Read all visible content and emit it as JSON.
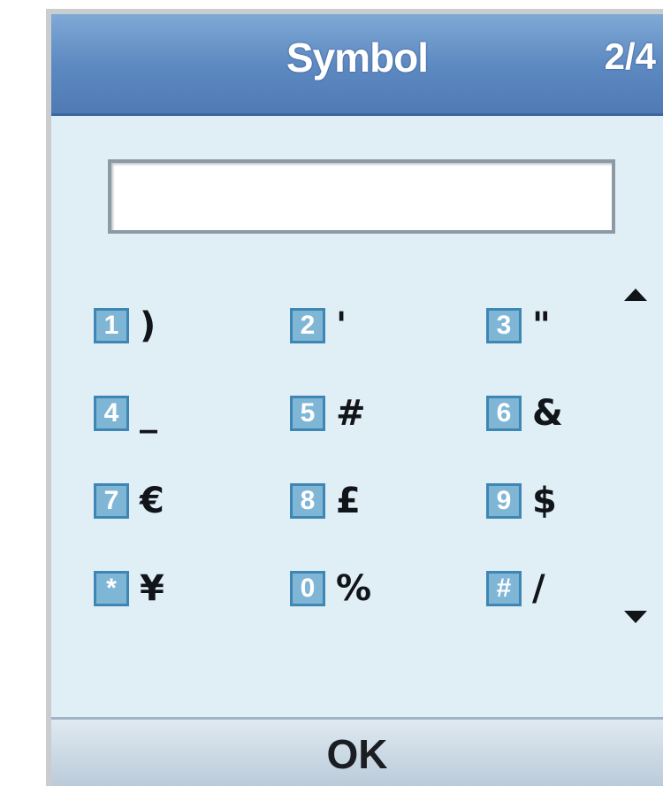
{
  "dialog": {
    "title": "Symbol",
    "page_indicator": "2/4",
    "input_value": ""
  },
  "symbols": [
    {
      "key": "1",
      "symbol": ")"
    },
    {
      "key": "2",
      "symbol": "'"
    },
    {
      "key": "3",
      "symbol": "\""
    },
    {
      "key": "4",
      "symbol": "_"
    },
    {
      "key": "5",
      "symbol": "#"
    },
    {
      "key": "6",
      "symbol": "&"
    },
    {
      "key": "7",
      "symbol": "€"
    },
    {
      "key": "8",
      "symbol": "£"
    },
    {
      "key": "9",
      "symbol": "$"
    },
    {
      "key": "*",
      "symbol": "¥"
    },
    {
      "key": "0",
      "symbol": "%"
    },
    {
      "key": "#",
      "symbol": "/"
    }
  ],
  "softkeys": {
    "center": "OK"
  },
  "colors": {
    "title_bar": "#5e8ac2",
    "panel_background": "#e0eef6",
    "key_badge": "#7fb6d6"
  }
}
